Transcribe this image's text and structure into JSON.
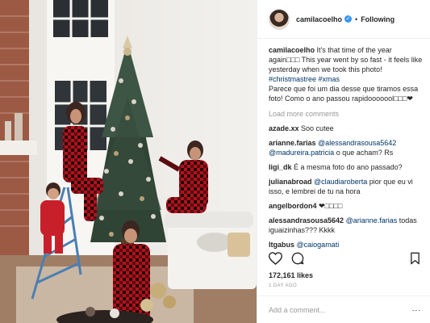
{
  "post": {
    "photo_alt": "",
    "author": "camilacoelho",
    "verified_glyph": "✓",
    "follow_label": "Following",
    "separator": "•"
  },
  "caption": {
    "author": "camilacoelho",
    "text1": " It's that time of the year again□□□ This year went by so fast - it feels like yesterday when we took this photo! ",
    "tag1": "#christmastree",
    "tag2": "#xmas",
    "text2": "Parece que foi um dia desse que tiramos essa foto! Como o ano passou rapidooooool□□□❤"
  },
  "load_more_label": "Load more comments",
  "comments": [
    {
      "user": "azade.xx",
      "mentions": [],
      "text": "Soo cutee"
    },
    {
      "user": "arianne.farias",
      "mention1": "@alessandrasousa5642",
      "mention2": "@madureira.patricia",
      "text": "o que acham? Rs"
    },
    {
      "user": "ligi_dk",
      "text": "É a mesma foto do ano passado?"
    },
    {
      "user": "julianabroad",
      "mention1": "@claudiaroberta",
      "text": "pior que eu vi isso, e lembrei de tu na hora"
    },
    {
      "user": "angelbordon4",
      "text": "❤□□□□"
    },
    {
      "user": "alessandrasousa5642",
      "mention1": "@arianne.farias",
      "text": "todas iguaizinhas??? Kkkk"
    },
    {
      "user": "ltgabus",
      "mention1": "@caiogamati"
    }
  ],
  "actions": {
    "like_icon": "heart-icon",
    "comment_icon": "comment-bubble-icon",
    "save_icon": "bookmark-icon"
  },
  "likes_text": "172,161 likes",
  "time_ago": "1 DAY AGO",
  "add_comment": {
    "placeholder": "Add a comment...",
    "more_label": "..."
  },
  "colors": {
    "link": "#003569",
    "muted": "#999999",
    "verified": "#3897f0",
    "plaid_red": "#b3121c"
  }
}
